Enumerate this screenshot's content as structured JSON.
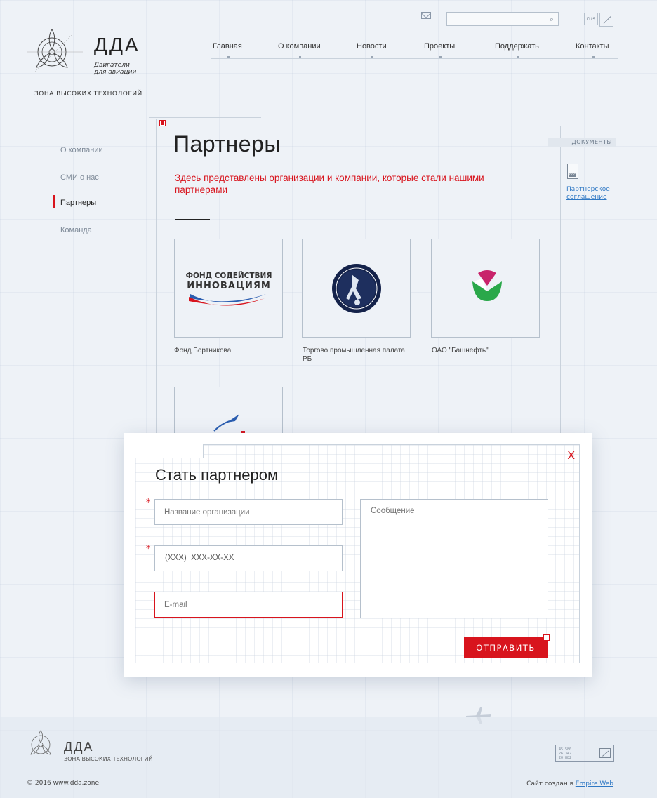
{
  "header": {
    "search_placeholder": "",
    "lang": "rus",
    "logo_title": "ДДА",
    "logo_subtitle": "Двигатели для авиации",
    "logo_tagline": "ЗОНА ВЫСОКИХ ТЕХНОЛОГИЙ"
  },
  "nav": {
    "items": [
      "Главная",
      "О компании",
      "Новости",
      "Проекты",
      "Поддержать",
      "Контакты"
    ]
  },
  "sidebar": {
    "items": [
      "О компании",
      "СМИ о нас",
      "Партнеры",
      "Команда"
    ],
    "active": "Партнеры"
  },
  "page": {
    "title": "Партнеры",
    "description": "Здесь представлены организации и компании, которые стали нашими партнерами"
  },
  "partners": [
    {
      "name": "Фонд Бортникова",
      "logo_line1": "ФОНД СОДЕЙСТВИЯ",
      "logo_line2": "ИННОВАЦИЯМ"
    },
    {
      "name": "Торгово промышленная палата РБ"
    },
    {
      "name": "ОАО \"Башнефть\""
    }
  ],
  "documents": {
    "label": "ДОКУМЕНТЫ",
    "items": [
      {
        "title": "Партнерское соглашение",
        "type": "doc"
      }
    ]
  },
  "modal": {
    "title": "Стать партнером",
    "close": "X",
    "org_placeholder": "Название организации",
    "phone_code": "(XXX)",
    "phone_number": "XXX-XX-XX",
    "email_placeholder": "E-mail",
    "message_placeholder": "Сообщение",
    "submit": "ОТПРАВИТЬ",
    "required_mark": "*"
  },
  "footer": {
    "logo_title": "ДДА",
    "logo_tagline": "ЗОНА ВЫСОКИХ ТЕХНОЛОГИЙ",
    "copyright": "© 2016  www.dda.zone",
    "credits_prefix": "Сайт создан в ",
    "credits_link": "Empire Web",
    "badge_line1": "45 580",
    "badge_line2": "26 342",
    "badge_line3": "20 882"
  },
  "colors": {
    "accent": "#d8141d",
    "link": "#2f78c4",
    "background": "#eef2f7"
  }
}
